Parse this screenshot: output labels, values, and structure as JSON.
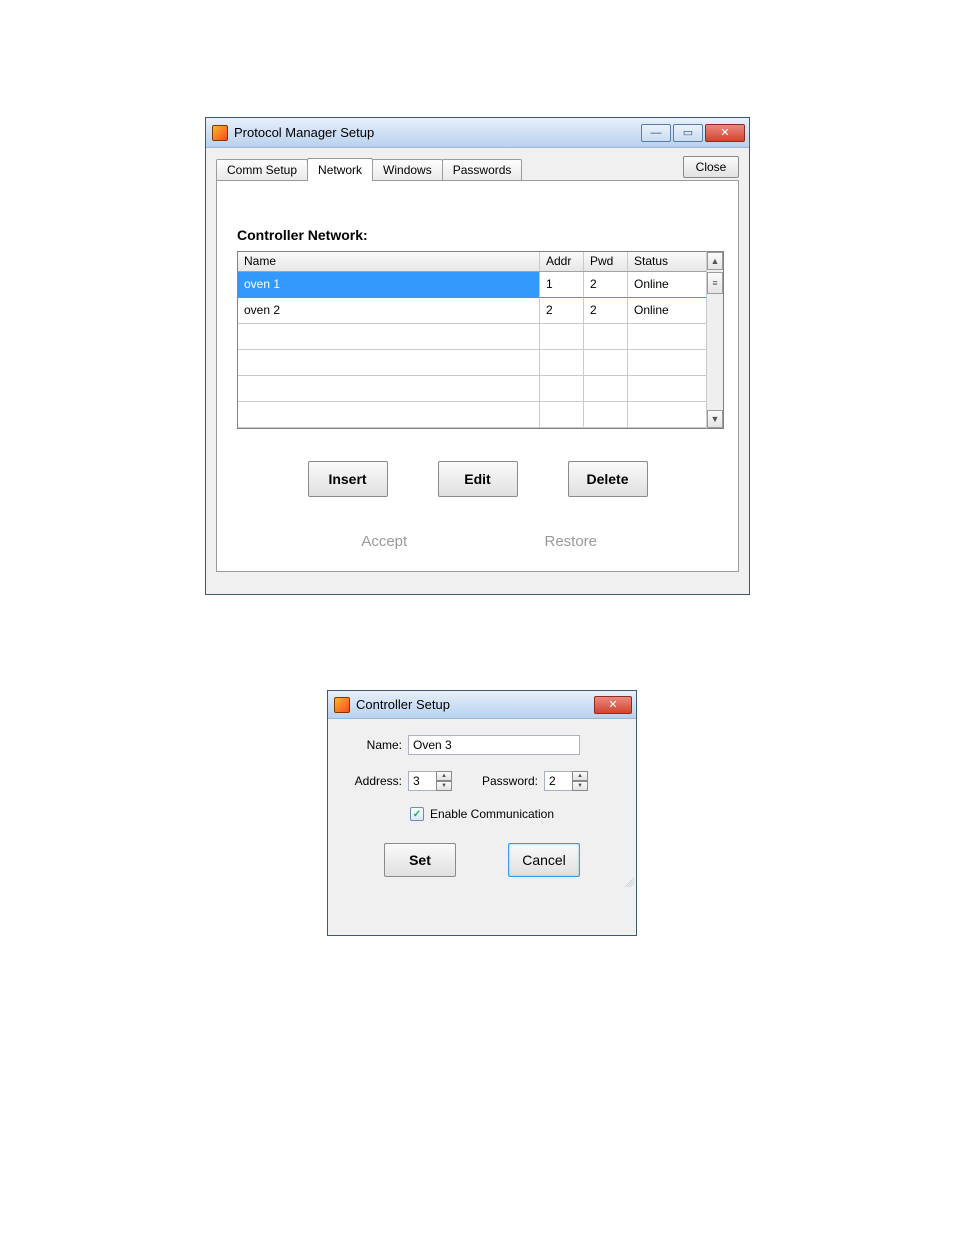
{
  "main_window": {
    "title": "Protocol Manager Setup",
    "close_top_label": "Close",
    "tabs": [
      {
        "label": "Comm Setup"
      },
      {
        "label": "Network"
      },
      {
        "label": "Windows"
      },
      {
        "label": "Passwords"
      }
    ],
    "active_tab_index": 1,
    "section_title": "Controller Network:",
    "grid": {
      "columns": {
        "name": "Name",
        "addr": "Addr",
        "pwd": "Pwd",
        "status": "Status"
      },
      "rows": [
        {
          "name": "oven 1",
          "addr": "1",
          "pwd": "2",
          "status": "Online",
          "selected": true
        },
        {
          "name": "oven 2",
          "addr": "2",
          "pwd": "2",
          "status": "Online",
          "selected": false
        }
      ],
      "empty_rows": 4
    },
    "buttons": {
      "insert": "Insert",
      "edit": "Edit",
      "delete": "Delete"
    },
    "bottom_buttons": {
      "accept": "Accept",
      "restore": "Restore"
    }
  },
  "dialog": {
    "title": "Controller Setup",
    "labels": {
      "name": "Name:",
      "address": "Address:",
      "password": "Password:",
      "enable": "Enable Communication"
    },
    "values": {
      "name": "Oven 3",
      "address": "3",
      "password": "2",
      "enable_checked": true
    },
    "buttons": {
      "set": "Set",
      "cancel": "Cancel"
    }
  }
}
